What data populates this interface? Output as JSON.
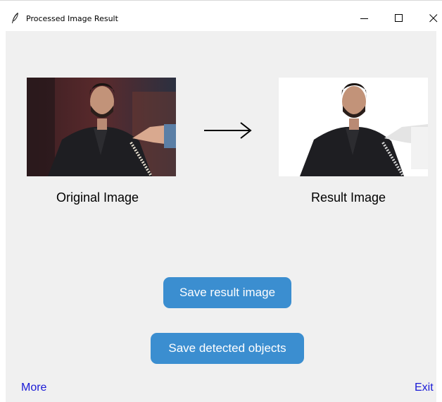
{
  "window": {
    "title": "Processed Image Result",
    "controls": {
      "minimize": "–",
      "maximize": "☐",
      "close": "✕"
    }
  },
  "images": {
    "original": {
      "caption": "Original Image"
    },
    "result": {
      "caption": "Result Image"
    },
    "arrow_icon": "right-arrow-icon"
  },
  "buttons": {
    "save_result": "Save result image",
    "save_detected": "Save detected objects"
  },
  "links": {
    "more": "More",
    "exit": "Exit"
  },
  "colors": {
    "button_bg": "#3b8ed0",
    "button_text": "#ffffff",
    "link": "#1a1ad6",
    "client_bg": "#f0f0f0"
  }
}
